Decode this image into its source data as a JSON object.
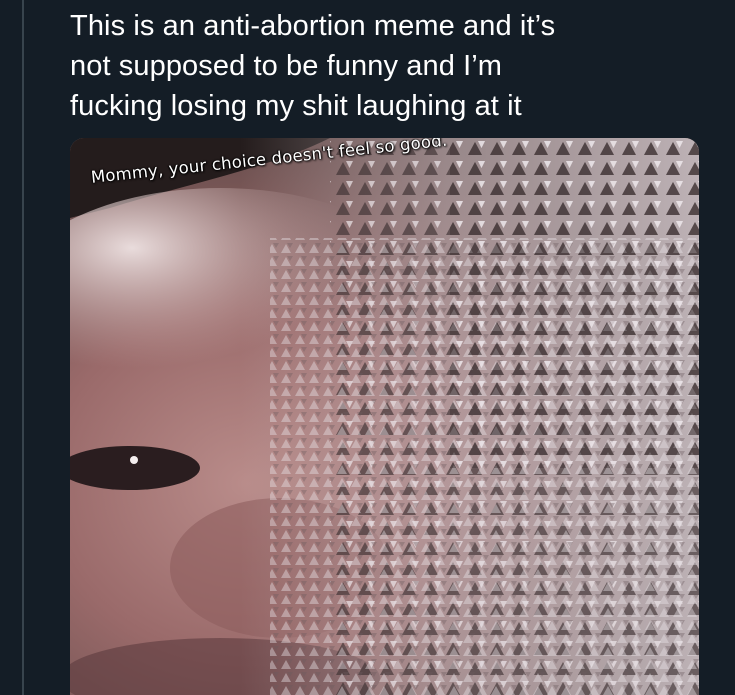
{
  "tweet": {
    "text_lines": [
      "This is an anti-abortion meme and it’s",
      "not supposed to be funny and I’m",
      "fucking losing my shit laughing at it"
    ]
  },
  "media": {
    "caption": "Mommy, your choice doesn't feel so good.",
    "description_icon": "baby-disintegrating-image"
  },
  "colors": {
    "background": "#141d26",
    "text": "#ffffff",
    "thread_line": "#38444d"
  }
}
